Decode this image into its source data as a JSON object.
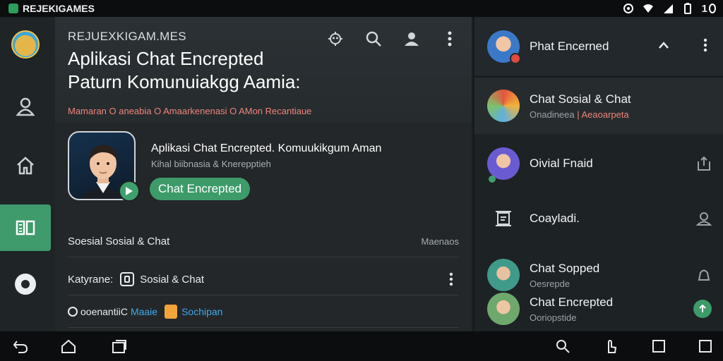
{
  "status_bar": {
    "app_name": "REJEKIGAMES",
    "clock": "1",
    "icons": [
      "sync-icon",
      "wifi-icon",
      "signal-icon",
      "battery-icon"
    ]
  },
  "rail": {
    "items": [
      {
        "name": "app-logo",
        "icon": "logo"
      },
      {
        "name": "profile",
        "icon": "person-icon"
      },
      {
        "name": "home",
        "icon": "home-icon"
      },
      {
        "name": "chat-list",
        "icon": "list-icon",
        "active": true
      },
      {
        "name": "record",
        "icon": "record-icon"
      }
    ]
  },
  "main": {
    "brand": "REJUEXKIGAM.MES",
    "title_line1": "Aplikasi Chat Encrepted",
    "title_line2": "Paturn Komunuiakgg Aamia:",
    "breadcrumbs": "Mamaran  O aneabia  O  Amaarkenenasi  O  AMon  Recantiaue",
    "actions": [
      "bug-icon",
      "search-icon",
      "account-icon",
      "more-vert-icon"
    ],
    "card": {
      "title": "Aplikasi Chat Encrepted. Komuukikgum Aman",
      "subtitle": "Kihal biibnasia & Knerepptieh",
      "button": "Chat Encrepted"
    },
    "category_row": {
      "label": "Soesial Sosial & Chat",
      "trailing": "Maenaos"
    },
    "kategori_row": {
      "label": "Katyrane:",
      "value": "Sosial & Chat"
    },
    "tags_row": {
      "prefix": "ooenantiiC",
      "tag1": "Maaie",
      "tag2": "Sochipan"
    }
  },
  "right_panel": {
    "header": {
      "name": "Phat Encerned"
    },
    "items": [
      {
        "name": "Chat Sosial & Chat",
        "sub_a": "Onadineea ",
        "sub_b": "| Aeaoarpeta",
        "trail": ""
      },
      {
        "name": "Oivial Fnaid",
        "sub_a": "",
        "sub_b": "",
        "trail": "share-icon"
      },
      {
        "name": "Coayladi.",
        "sub_a": "",
        "sub_b": "",
        "trail": "user-icon"
      },
      {
        "name": "Chat Sopped",
        "sub_a": "Oesrepde",
        "sub_b": "",
        "trail": "bell-icon"
      },
      {
        "name": "Chat Encrepted",
        "sub_a": "Ooriopstide",
        "sub_b": "",
        "trail": "up-badge"
      }
    ]
  },
  "nav_bar": {
    "left": [
      "back-icon",
      "home-icon",
      "recents-icon"
    ],
    "right": [
      "search-icon",
      "touch-icon",
      "square-icon",
      "square-outline-icon"
    ]
  },
  "colors": {
    "accent_green": "#3d9b69",
    "breadcrumb_red": "#ee8579",
    "tag_blue": "#45a7e8"
  }
}
